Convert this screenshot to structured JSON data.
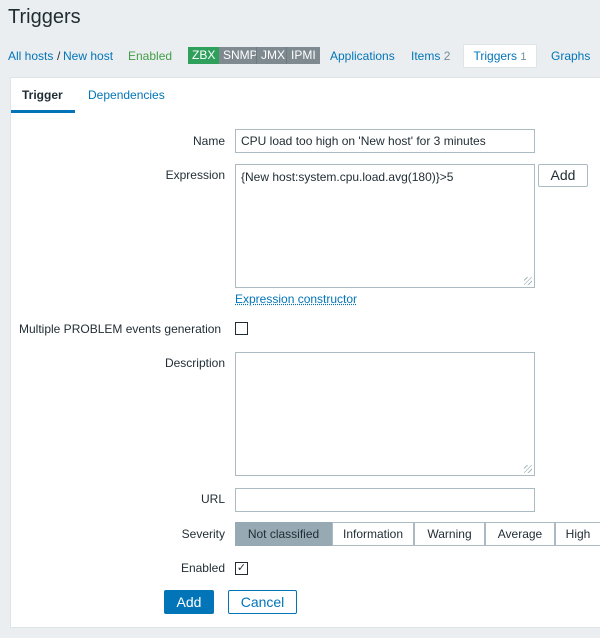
{
  "title": "Triggers",
  "nav": {
    "all_hosts": "All hosts",
    "sep": "/",
    "host": "New host",
    "status": "Enabled",
    "tags": [
      "ZBX",
      "SNMP",
      "JMX",
      "IPMI"
    ],
    "applications": "Applications",
    "items": "Items",
    "items_count": "2",
    "triggers": "Triggers",
    "triggers_count": "1",
    "graphs": "Graphs"
  },
  "colors": {
    "accent": "#0275b8",
    "enabled": "#429e47",
    "zbx": "#2f9f5c",
    "tag_gray": "#7f8a90",
    "severity_selected": "#97aab3"
  },
  "tabs": [
    "Trigger",
    "Dependencies"
  ],
  "form": {
    "name_label": "Name",
    "name_value": "CPU load too high on 'New host' for 3 minutes",
    "expression_label": "Expression",
    "expression_value": "{New host:system.cpu.load.avg(180)}>5",
    "add_expr": "Add",
    "expression_constructor": "Expression constructor",
    "multiple_label": "Multiple PROBLEM events generation",
    "multiple_checked": false,
    "description_label": "Description",
    "description_value": "",
    "url_label": "URL",
    "url_value": "",
    "severity_label": "Severity",
    "severities": [
      "Not classified",
      "Information",
      "Warning",
      "Average",
      "High"
    ],
    "severity_selected": "Not classified",
    "enabled_label": "Enabled",
    "enabled_checked": true,
    "check_mark": "✓",
    "add_button": "Add",
    "cancel_button": "Cancel"
  }
}
